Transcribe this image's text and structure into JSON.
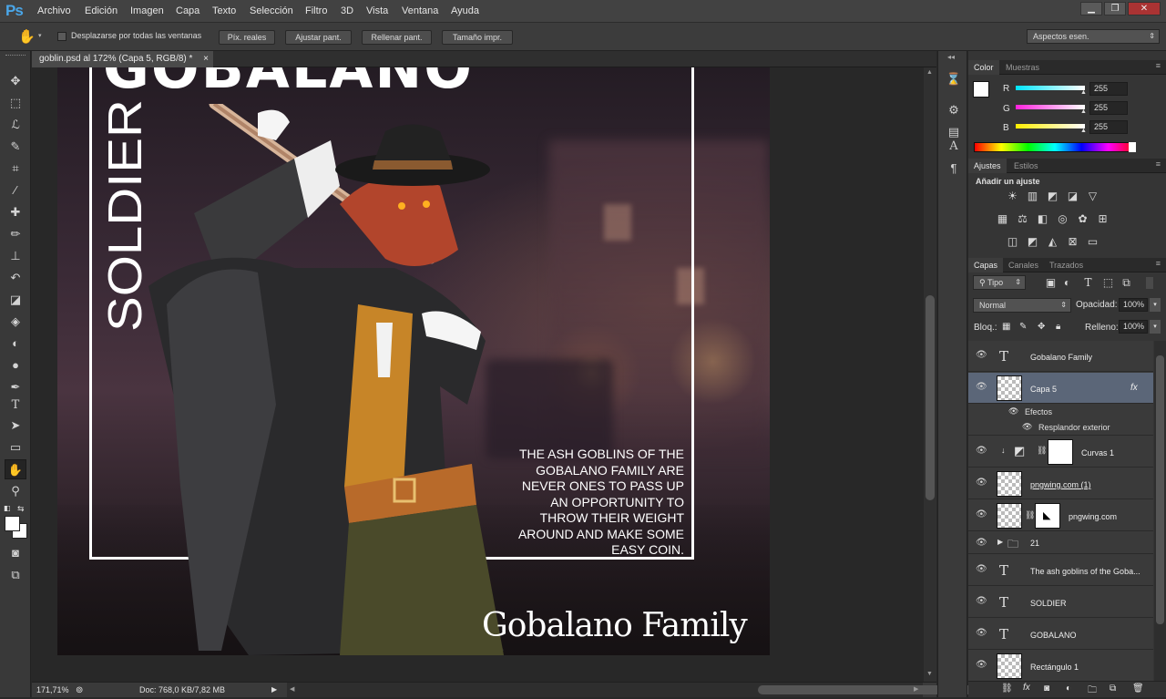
{
  "app": {
    "logo": "Ps",
    "accent": "#4aa6e8"
  },
  "menu": [
    "Archivo",
    "Edición",
    "Imagen",
    "Capa",
    "Texto",
    "Selección",
    "Filtro",
    "3D",
    "Vista",
    "Ventana",
    "Ayuda"
  ],
  "window_controls": {
    "minimize": "▁",
    "restore": "❐",
    "close": "✕"
  },
  "options_bar": {
    "scroll_all_label": "Desplazarse por todas las ventanas",
    "buttons": [
      "Píx. reales",
      "Ajustar pant.",
      "Rellenar pant.",
      "Tamaño impr."
    ],
    "workspace": "Aspectos esen."
  },
  "document": {
    "tab_title": "goblin.psd al 172% (Capa 5, RGB/8) *",
    "artwork": {
      "big_title": "GOBALANO",
      "vertical_text": "SOLDIER",
      "blurb": "The ash goblins of the Gobalano Family are never ones to pass up an opportunity to throw their weight around and make some easy coin.",
      "signature": "Gobalano Family"
    }
  },
  "status": {
    "zoom": "171,71%",
    "doc_info": "Doc: 768,0 KB/7,82 MB"
  },
  "panels": {
    "color": {
      "tabs": [
        "Color",
        "Muestras"
      ],
      "channels": [
        {
          "label": "R",
          "value": "255",
          "color": "#00e5ff"
        },
        {
          "label": "G",
          "value": "255",
          "color": "#ff22dd"
        },
        {
          "label": "B",
          "value": "255",
          "color": "#ffee00"
        }
      ]
    },
    "adjustments": {
      "tabs": [
        "Ajustes",
        "Estilos"
      ],
      "heading": "Añadir un ajuste",
      "rows": [
        [
          "brightness-icon",
          "levels-icon",
          "curves-icon",
          "exposure-icon",
          "vibrance-icon"
        ],
        [
          "hue-sat-icon",
          "color-balance-icon",
          "bw-icon",
          "photo-filter-icon",
          "channel-mixer-icon",
          "color-lookup-icon"
        ],
        [
          "invert-icon",
          "posterize-icon",
          "threshold-icon",
          "selective-color-icon",
          "gradient-map-icon"
        ]
      ]
    },
    "layers": {
      "tabs": [
        "Capas",
        "Canales",
        "Trazados"
      ],
      "filter": "Tipo",
      "blend_mode": "Normal",
      "opacity_label": "Opacidad:",
      "opacity": "100%",
      "lock_label": "Bloq.:",
      "fill_label": "Relleno:",
      "fill": "100%",
      "items": [
        {
          "name": "Gobalano Family",
          "kind": "text"
        },
        {
          "name": "Capa 5",
          "kind": "pixel",
          "selected": true,
          "fx": "fx"
        },
        {
          "name": "Efectos",
          "kind": "effects"
        },
        {
          "name": "Resplandor exterior",
          "kind": "effect"
        },
        {
          "name": "Curvas 1",
          "kind": "adjustment"
        },
        {
          "name": "pngwing.com (1)",
          "kind": "pixel"
        },
        {
          "name": "pngwing.com",
          "kind": "masked"
        },
        {
          "name": "21",
          "kind": "group"
        },
        {
          "name": "The ash goblins of the Goba...",
          "kind": "text"
        },
        {
          "name": "SOLDIER",
          "kind": "text"
        },
        {
          "name": "GOBALANO",
          "kind": "text"
        },
        {
          "name": "Rectángulo 1",
          "kind": "shape"
        }
      ]
    }
  }
}
